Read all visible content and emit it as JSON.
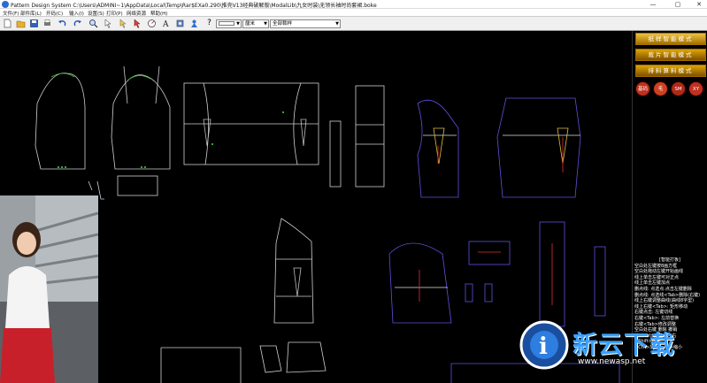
{
  "window": {
    "title": "Pattern Design System    C:\\Users\\ADMINI~1\\AppData\\Local\\Temp\\Rar$EXa0.290\\推壳V13经典破解版\\ModalLib\\九女时装\\无领长袖时尚套裙.boke",
    "minimize": "—",
    "maximize": "▢",
    "close": "✕"
  },
  "menu": [
    "文件(F)",
    "部件库(L)",
    "开码(C)",
    "输入(I)",
    "设置(S)",
    "打印(P)",
    "网络资源",
    "帮助(H)"
  ],
  "toolbar": {
    "unit_select": "厘米",
    "piece_select": "全部裁样",
    "help": "?"
  },
  "right_panel": {
    "mode_buttons": [
      "纸样智能模式",
      "裁片智能模式",
      "排料算料模式"
    ],
    "circle_buttons": [
      {
        "label": "基码",
        "color": "#c0301c"
      },
      {
        "label": "毛",
        "color": "#d04020"
      },
      {
        "label": "SM",
        "color": "#b02818"
      },
      {
        "label": "XY",
        "color": "#c03020"
      }
    ],
    "help_title": "[智能打板]",
    "help_lines": [
      "空白处左键按8画方框",
      "空白处拖动左键开始画线",
      "线上单击左键可对正点",
      "线上单击左键加点",
      "删点线: 点选点.点击左键删除",
      "删点线: 点选线<Tab>删除(右键)",
      "线上右键调整曲线(曲线8字型)",
      "线上右键<Tab>: 矩形移动",
      "右键点击: 左键切线",
      "右键<Tab>: 左前替换",
      "右键<Tab>修改调整",
      "空白处右键 删除 撤销",
      "按<Ctrl>连选中左右",
      "<Shift>操作",
      "<Ctrl>放大 <Alt>缩小"
    ]
  },
  "watermark": {
    "text": "新云下载",
    "url": "www.newasp.net"
  }
}
